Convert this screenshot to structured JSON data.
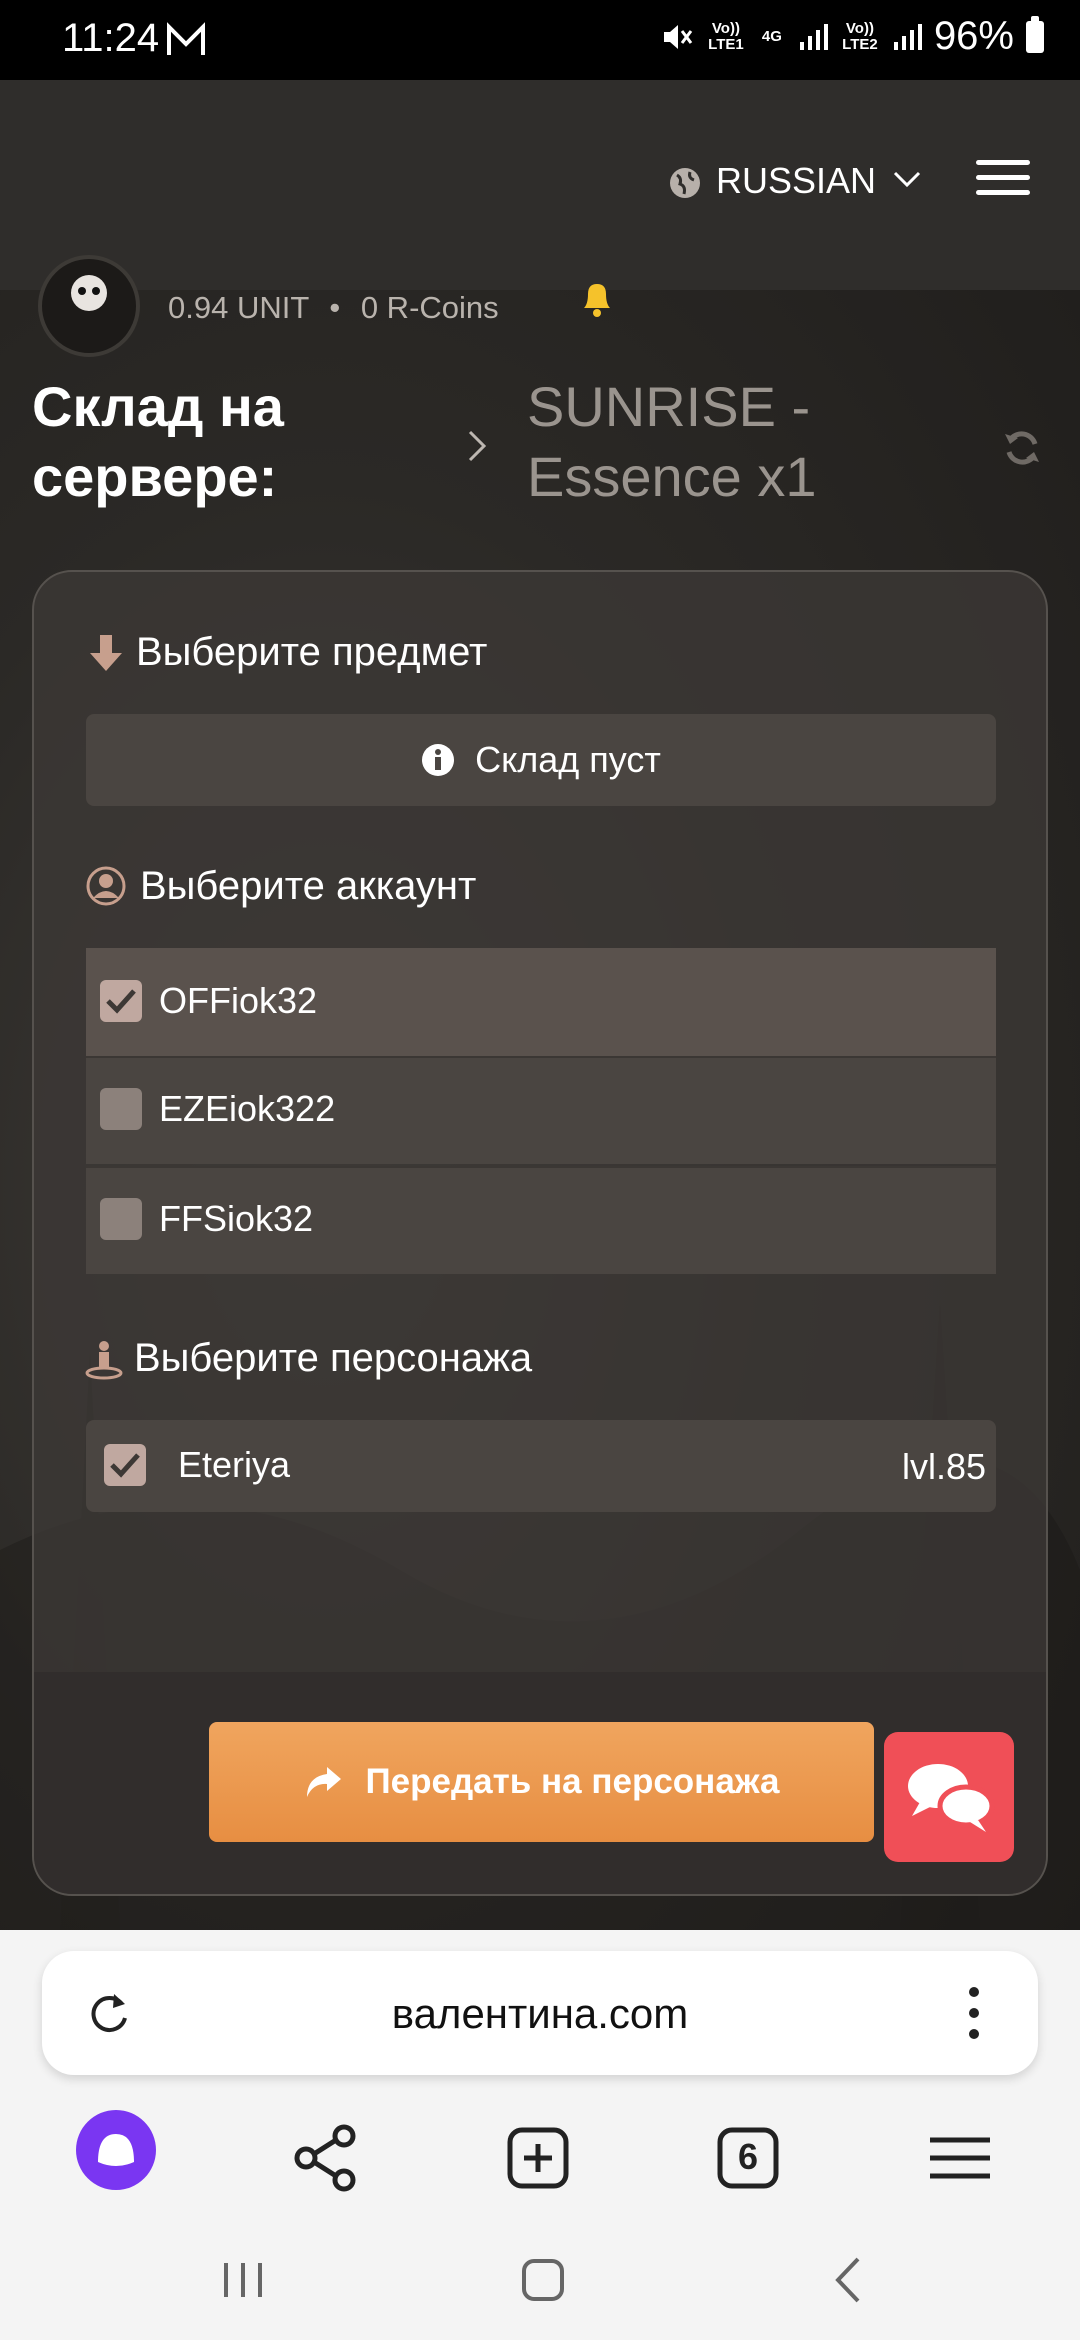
{
  "status_bar": {
    "time": "11:24",
    "sim1": "Vo)) LTE1",
    "net": "4G",
    "sim2": "Vo)) LTE2",
    "battery": "96%"
  },
  "header": {
    "language": "RUSSIAN"
  },
  "user": {
    "balance_unit": "0.94 UNIT",
    "dot": "•",
    "balance_coins": "0 R-Coins"
  },
  "page": {
    "title": "Склад на сервере:",
    "server": "SUNRISE - Essence x1"
  },
  "item_section": {
    "label": "Выберите предмет",
    "empty_text": "Склад пуст"
  },
  "account_section": {
    "label": "Выберите аккаунт",
    "accounts": [
      {
        "name": "OFFiok32",
        "checked": true
      },
      {
        "name": "EZEiok322",
        "checked": false
      },
      {
        "name": "FFSiok32",
        "checked": false
      }
    ]
  },
  "character_section": {
    "label": "Выберите персонажа",
    "character": {
      "name": "Eteriya",
      "level": "lvl.85",
      "checked": true
    }
  },
  "actions": {
    "transfer_label": "Передать на персонажа"
  },
  "browser": {
    "url": "валентина.com",
    "tabs_count": "6"
  },
  "colors": {
    "accent_orange": "#e98f43",
    "chat_red": "#f04f57",
    "alice_purple": "#7a36f2"
  }
}
